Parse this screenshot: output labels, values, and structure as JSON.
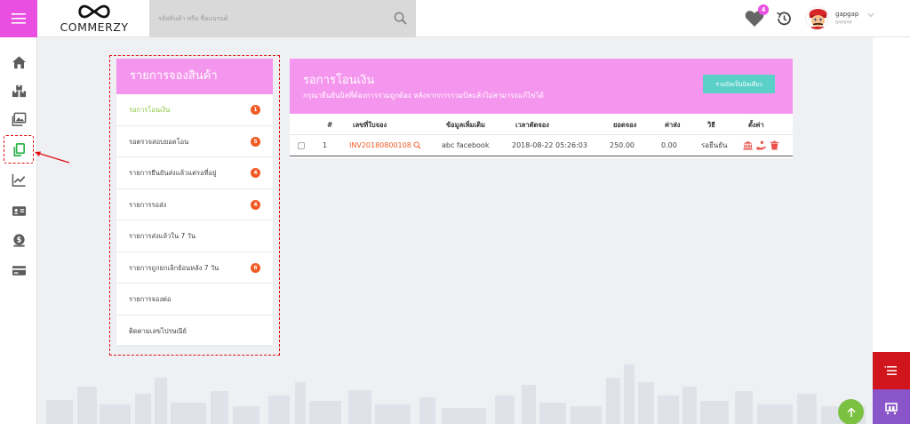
{
  "header": {
    "logo_text": "COMMERZY",
    "search_placeholder": "รหัสสินค้า หรือ ชื่อแบรนด์",
    "notif_count": "4",
    "user_name": "gapgap",
    "user_sub": "gapgap"
  },
  "left_panel": {
    "title": "รายการจองสินค้า",
    "items": [
      {
        "label": "รอการโอนเงิน",
        "badge": "1"
      },
      {
        "label": "รอตรวจสอบยอดโอน",
        "badge": "5"
      },
      {
        "label": "รายการยืนยันส่งแล้วแต่รอที่อยู่",
        "badge": "4"
      },
      {
        "label": "รายการรอส่ง",
        "badge": "4"
      },
      {
        "label": "รายการส่งแล้วใน 7 วัน",
        "badge": ""
      },
      {
        "label": "รายการถูกยกเลิกย้อนหลัง 7 วัน",
        "badge": "6"
      },
      {
        "label": "รายการจองต่อ",
        "badge": ""
      },
      {
        "label": "ติดตามเลขไปรษณีย์",
        "badge": ""
      }
    ]
  },
  "main_panel": {
    "title": "รอการโอนเงิน",
    "subtitle": "กรุณายืนยันบิลที่ต้องการรวมถูกต้อง หลังจากการรวมบิลแล้วไม่สามารถแก้ไขได้",
    "merge_button": "รวมบิลเป็นบิลเดียว",
    "columns": [
      "#",
      "เลขที่ใบจอง",
      "ข้อมูลเพิ่มเติม",
      "เวลาตัดจอง",
      "ยอดจอง",
      "ค่าส่ง",
      "วิธี",
      "ตั้งค่า"
    ],
    "rows": [
      {
        "no": "1",
        "invoice": "INV20180800108",
        "info": "abc facebook",
        "time": "2018-08-22 05:26:03",
        "amount": "250.00",
        "shipping": "0.00",
        "method": "รอยืนยัน"
      }
    ]
  },
  "colors": {
    "brand_pink": "#f596ee",
    "menu_magenta": "#e94fe0",
    "accent_green": "#8dc63f",
    "badge_orange": "#f15a24",
    "teal_button": "#5ad0c8",
    "fab_red": "#d0161c",
    "fab_purple": "#8a55c8"
  },
  "icons": {
    "sidebar": [
      "home-icon",
      "boxes-icon",
      "gallery-icon",
      "copy-icon",
      "chart-icon",
      "id-card-icon",
      "money-bag-icon",
      "credit-card-icon"
    ],
    "actions": [
      "bank-icon",
      "pay-hand-icon",
      "trash-icon"
    ]
  }
}
